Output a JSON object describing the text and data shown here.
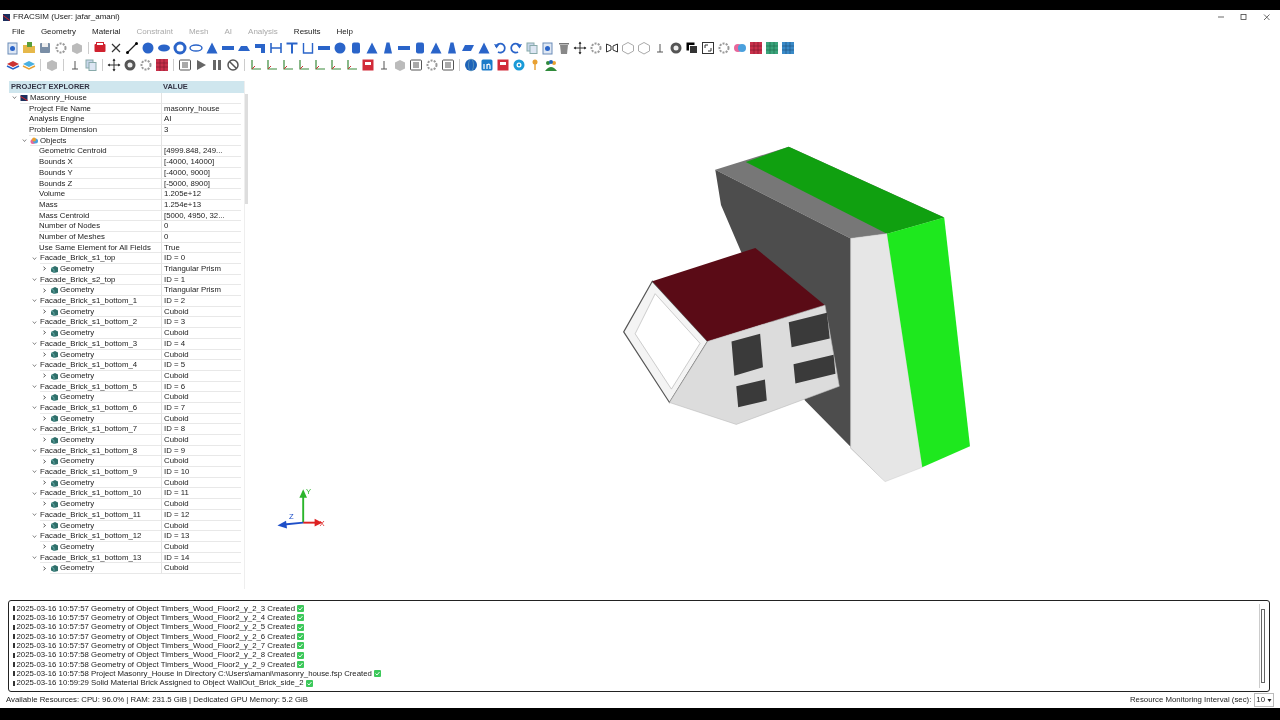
{
  "window": {
    "title": "FRACSIM (User: jafar_amani)"
  },
  "menu": [
    {
      "label": "File",
      "disabled": false
    },
    {
      "label": "Geometry",
      "disabled": false
    },
    {
      "label": "Material",
      "disabled": false
    },
    {
      "label": "Constraint",
      "disabled": true
    },
    {
      "label": "Mesh",
      "disabled": true
    },
    {
      "label": "AI",
      "disabled": true
    },
    {
      "label": "Analysis",
      "disabled": true
    },
    {
      "label": "Results",
      "disabled": false
    },
    {
      "label": "Help",
      "disabled": false
    }
  ],
  "explorer": {
    "columns": [
      "PROJECT EXPLORER",
      "VALUE"
    ],
    "tree": [
      {
        "label": "Masonry_House",
        "kind": "project",
        "expanded": true,
        "children": [
          {
            "label": "Project File Name",
            "value": "masonry_house"
          },
          {
            "label": "Analysis Engine",
            "value": "AI"
          },
          {
            "label": "Problem Dimension",
            "value": "3"
          },
          {
            "label": "Objects",
            "kind": "objects",
            "expanded": true,
            "children": [
              {
                "label": "Geometric Centroid",
                "value": "[4999.848, 249..."
              },
              {
                "label": "Bounds X",
                "value": "[-4000, 14000]"
              },
              {
                "label": "Bounds Y",
                "value": "[-4000, 9000]"
              },
              {
                "label": "Bounds Z",
                "value": "[-5000, 8900]"
              },
              {
                "label": "Volume",
                "value": "1.205e+12"
              },
              {
                "label": "Mass",
                "value": "1.254e+13"
              },
              {
                "label": "Mass Centroid",
                "value": "[5000, 4950, 32..."
              },
              {
                "label": "Number of Nodes",
                "value": "0"
              },
              {
                "label": "Number of Meshes",
                "value": "0"
              },
              {
                "label": "Use Same Element for All Fields",
                "value": "True"
              },
              {
                "label": "Facade_Brick_s1_top",
                "value": "ID = 0",
                "expanded": true,
                "children": [
                  {
                    "label": "Geometry",
                    "kind": "geometry",
                    "value": "Triangular Prism",
                    "expanded": false
                  }
                ]
              },
              {
                "label": "Facade_Brick_s2_top",
                "value": "ID = 1",
                "expanded": true,
                "children": [
                  {
                    "label": "Geometry",
                    "kind": "geometry",
                    "value": "Triangular Prism",
                    "expanded": false
                  }
                ]
              },
              {
                "label": "Facade_Brick_s1_bottom_1",
                "value": "ID = 2",
                "expanded": true,
                "children": [
                  {
                    "label": "Geometry",
                    "kind": "geometry",
                    "value": "Cuboid",
                    "expanded": false
                  }
                ]
              },
              {
                "label": "Facade_Brick_s1_bottom_2",
                "value": "ID = 3",
                "expanded": true,
                "children": [
                  {
                    "label": "Geometry",
                    "kind": "geometry",
                    "value": "Cuboid",
                    "expanded": false
                  }
                ]
              },
              {
                "label": "Facade_Brick_s1_bottom_3",
                "value": "ID = 4",
                "expanded": true,
                "children": [
                  {
                    "label": "Geometry",
                    "kind": "geometry",
                    "value": "Cuboid",
                    "expanded": false
                  }
                ]
              },
              {
                "label": "Facade_Brick_s1_bottom_4",
                "value": "ID = 5",
                "expanded": true,
                "children": [
                  {
                    "label": "Geometry",
                    "kind": "geometry",
                    "value": "Cuboid",
                    "expanded": false
                  }
                ]
              },
              {
                "label": "Facade_Brick_s1_bottom_5",
                "value": "ID = 6",
                "expanded": true,
                "children": [
                  {
                    "label": "Geometry",
                    "kind": "geometry",
                    "value": "Cuboid",
                    "expanded": false
                  }
                ]
              },
              {
                "label": "Facade_Brick_s1_bottom_6",
                "value": "ID = 7",
                "expanded": true,
                "children": [
                  {
                    "label": "Geometry",
                    "kind": "geometry",
                    "value": "Cuboid",
                    "expanded": false
                  }
                ]
              },
              {
                "label": "Facade_Brick_s1_bottom_7",
                "value": "ID = 8",
                "expanded": true,
                "children": [
                  {
                    "label": "Geometry",
                    "kind": "geometry",
                    "value": "Cuboid",
                    "expanded": false
                  }
                ]
              },
              {
                "label": "Facade_Brick_s1_bottom_8",
                "value": "ID = 9",
                "expanded": true,
                "children": [
                  {
                    "label": "Geometry",
                    "kind": "geometry",
                    "value": "Cuboid",
                    "expanded": false
                  }
                ]
              },
              {
                "label": "Facade_Brick_s1_bottom_9",
                "value": "ID = 10",
                "expanded": true,
                "children": [
                  {
                    "label": "Geometry",
                    "kind": "geometry",
                    "value": "Cuboid",
                    "expanded": false
                  }
                ]
              },
              {
                "label": "Facade_Brick_s1_bottom_10",
                "value": "ID = 11",
                "expanded": true,
                "children": [
                  {
                    "label": "Geometry",
                    "kind": "geometry",
                    "value": "Cuboid",
                    "expanded": false
                  }
                ]
              },
              {
                "label": "Facade_Brick_s1_bottom_11",
                "value": "ID = 12",
                "expanded": true,
                "children": [
                  {
                    "label": "Geometry",
                    "kind": "geometry",
                    "value": "Cuboid",
                    "expanded": false
                  }
                ]
              },
              {
                "label": "Facade_Brick_s1_bottom_12",
                "value": "ID = 13",
                "expanded": true,
                "children": [
                  {
                    "label": "Geometry",
                    "kind": "geometry",
                    "value": "Cuboid",
                    "expanded": false
                  }
                ]
              },
              {
                "label": "Facade_Brick_s1_bottom_13",
                "value": "ID = 14",
                "expanded": true,
                "children": [
                  {
                    "label": "Geometry",
                    "kind": "geometry",
                    "value": "Cuboid",
                    "expanded": false
                  }
                ]
              }
            ]
          }
        ]
      }
    ]
  },
  "viewport": {
    "axes": [
      "Y",
      "Z",
      "X"
    ]
  },
  "log": [
    "2025-03-16 10:57:57 Geometry of Object Timbers_Wood_Floor2_y_2_3 Created",
    "2025-03-16 10:57:57 Geometry of Object Timbers_Wood_Floor2_y_2_4 Created",
    "2025-03-16 10:57:57 Geometry of Object Timbers_Wood_Floor2_y_2_5 Created",
    "2025-03-16 10:57:57 Geometry of Object Timbers_Wood_Floor2_y_2_6 Created",
    "2025-03-16 10:57:57 Geometry of Object Timbers_Wood_Floor2_y_2_7 Created",
    "2025-03-16 10:57:58 Geometry of Object Timbers_Wood_Floor2_y_2_8 Created",
    "2025-03-16 10:57:58 Geometry of Object Timbers_Wood_Floor2_y_2_9 Created",
    "2025-03-16 10:57:58 Project Masonry_House in Directory C:\\Users\\amani\\masonry_house.fsp Created",
    "2025-03-16 10:59:29 Solid Material Brick Assigned to Object WallOut_Brick_side_2"
  ],
  "status_bar": {
    "resources": "Available Resources: CPU: 96.0% | RAM: 231.5 GiB | Dedicated GPU Memory: 5.2 GiB",
    "interval_label": "Resource Monitoring Interval (sec):",
    "interval_value": "10"
  }
}
